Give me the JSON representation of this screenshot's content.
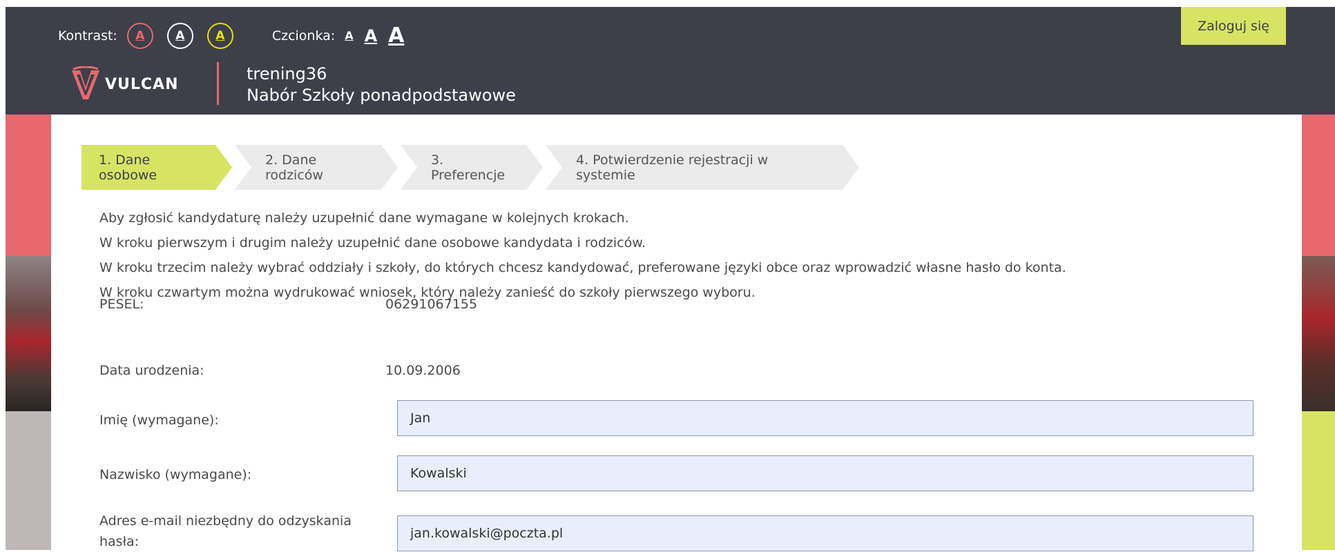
{
  "header": {
    "contrast_label": "Kontrast:",
    "contrast_options": [
      "A",
      "A",
      "A"
    ],
    "font_label": "Czcionka:",
    "font_options": [
      "A",
      "A",
      "A"
    ],
    "login_label": "Zaloguj się",
    "logo_text": "VULCAN",
    "site_name": "trening36",
    "site_subtitle": "Nabór Szkoły ponadpodstawowe"
  },
  "steps": [
    {
      "label": "1. Dane osobowe",
      "active": true
    },
    {
      "label": "2. Dane rodziców",
      "active": false
    },
    {
      "label": "3. Preferencje",
      "active": false
    },
    {
      "label": "4. Potwierdzenie rejestracji w systemie",
      "active": false
    }
  ],
  "intro": [
    "Aby zgłosić kandydaturę należy uzupełnić dane wymagane w kolejnych krokach.",
    "W kroku pierwszym i drugim należy uzupełnić dane osobowe kandydata i rodziców.",
    "W kroku trzecim należy wybrać oddziały i szkoły, do których chcesz kandydować, preferowane języki obce oraz wprowadzić własne hasło do konta.",
    "W kroku czwartym można wydrukować wniosek, który należy zanieść do szkoły pierwszego wyboru."
  ],
  "form": {
    "pesel_label": "PESEL:",
    "pesel_value": "06291067155",
    "birth_label": "Data urodzenia:",
    "birth_value": "10.09.2006",
    "first_name_label": "Imię (wymagane):",
    "first_name_value": "Jan",
    "last_name_label": "Nazwisko (wymagane):",
    "last_name_value": "Kowalski",
    "email_label_line1": "Adres e-mail niezbędny do odzyskania",
    "email_label_line2": "hasła:",
    "email_value": "jan.kowalski@poczta.pl"
  },
  "colors": {
    "header_bg": "#3d3f49",
    "accent_green": "#d7e463",
    "accent_red": "#e8686e",
    "input_bg": "#e8effb"
  }
}
